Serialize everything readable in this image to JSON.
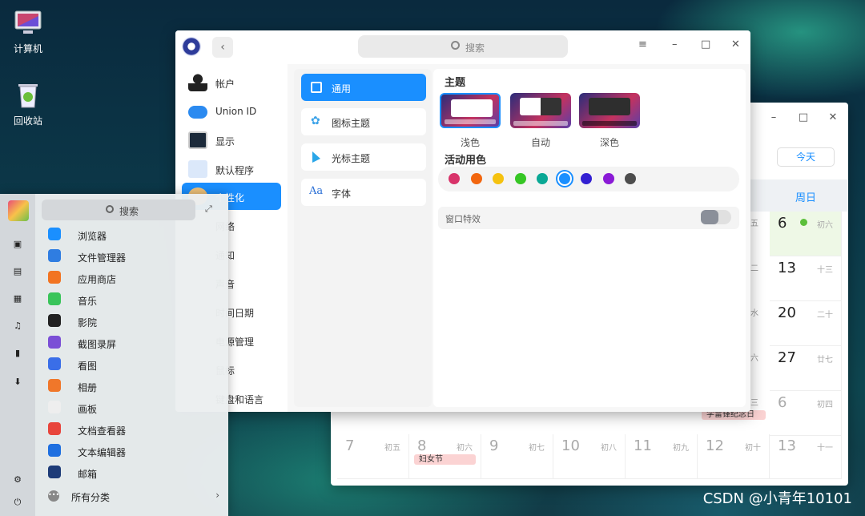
{
  "desktop": {
    "icons": [
      {
        "label": "计算机"
      },
      {
        "label": "回收站"
      }
    ],
    "watermark": "CSDN @小青年10101"
  },
  "calendar": {
    "today_label": "今天",
    "sunday_header": "周日",
    "cells": [
      {
        "day": "6",
        "lunar": "初六",
        "dim": false,
        "special": "today"
      },
      {
        "day": "13",
        "lunar": "十三",
        "dim": false
      },
      {
        "day": "20",
        "lunar": "二十",
        "dim": false
      },
      {
        "day": "27",
        "lunar": "廿七",
        "dim": false
      },
      {
        "day": "6",
        "lunar": "初四",
        "dim": true
      }
    ],
    "left_col_fragments": [
      "五",
      "二",
      "水",
      "六",
      "三"
    ],
    "bottom_row": [
      {
        "day": "7",
        "lunar": "初五"
      },
      {
        "day": "8",
        "lunar": "初六",
        "event": "妇女节"
      },
      {
        "day": "9",
        "lunar": "初七"
      },
      {
        "day": "10",
        "lunar": "初八"
      },
      {
        "day": "11",
        "lunar": "初九"
      },
      {
        "day": "12",
        "lunar": "初十"
      },
      {
        "day": "13",
        "lunar": "十一"
      }
    ],
    "partial_event": "学雷锋纪念日"
  },
  "settings": {
    "search_placeholder": "搜索",
    "nav": [
      {
        "label": "帐户",
        "icon": "account-icon"
      },
      {
        "label": "Union ID",
        "icon": "cloud-icon"
      },
      {
        "label": "显示",
        "icon": "display-icon"
      },
      {
        "label": "默认程序",
        "icon": "default-apps-icon"
      },
      {
        "label": "个性化",
        "icon": "personalization-icon",
        "active": true
      },
      {
        "label": "网络",
        "icon": "network-icon"
      },
      {
        "label": "通知",
        "icon": "notification-icon"
      },
      {
        "label": "声音",
        "icon": "sound-icon"
      },
      {
        "label": "时间日期",
        "icon": "time-icon"
      },
      {
        "label": "电源管理",
        "icon": "power-icon"
      },
      {
        "label": "鼠标",
        "icon": "mouse-icon"
      },
      {
        "label": "键盘和语言",
        "icon": "keyboard-icon"
      }
    ],
    "sub_nav": [
      {
        "label": "通用",
        "active": true
      },
      {
        "label": "图标主题"
      },
      {
        "label": "光标主题"
      },
      {
        "label": "字体"
      }
    ],
    "theme_title": "主题",
    "themes": [
      {
        "label": "浅色"
      },
      {
        "label": "自动"
      },
      {
        "label": "深色"
      }
    ],
    "accent_title": "活动用色",
    "accent_colors": [
      "#d8336a",
      "#f2660f",
      "#f5c20f",
      "#36c624",
      "#0aa895",
      "#1a8fff",
      "#3320d2",
      "#8a1ad6",
      "#4d4d4d"
    ],
    "selected_accent": "#1a8fff",
    "window_effect_label": "窗口特效",
    "window_effect_on": false
  },
  "launcher": {
    "search_placeholder": "搜索",
    "apps": [
      {
        "label": "浏览器",
        "color": "#1a8fff"
      },
      {
        "label": "文件管理器",
        "color": "#2f7de1"
      },
      {
        "label": "应用商店",
        "color": "#f27422"
      },
      {
        "label": "音乐",
        "color": "#39c45a"
      },
      {
        "label": "影院",
        "color": "#222222"
      },
      {
        "label": "截图录屏",
        "color": "#7b4fd6"
      },
      {
        "label": "看图",
        "color": "#3a6ee8"
      },
      {
        "label": "相册",
        "color": "#f0772a"
      },
      {
        "label": "画板",
        "color": "#eeeeee"
      },
      {
        "label": "文档查看器",
        "color": "#e8453c"
      },
      {
        "label": "文本编辑器",
        "color": "#1e6fe0"
      },
      {
        "label": "邮箱",
        "color": "#1d3b78"
      }
    ],
    "all_categories": "所有分类"
  }
}
